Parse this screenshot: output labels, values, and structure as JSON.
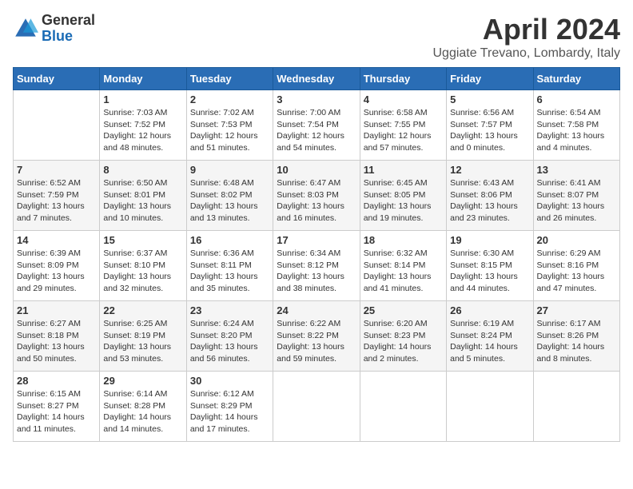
{
  "header": {
    "logo": {
      "general": "General",
      "blue": "Blue"
    },
    "title": "April 2024",
    "location": "Uggiate Trevano, Lombardy, Italy"
  },
  "calendar": {
    "days_of_week": [
      "Sunday",
      "Monday",
      "Tuesday",
      "Wednesday",
      "Thursday",
      "Friday",
      "Saturday"
    ],
    "weeks": [
      [
        {
          "day": "",
          "info": ""
        },
        {
          "day": "1",
          "info": "Sunrise: 7:03 AM\nSunset: 7:52 PM\nDaylight: 12 hours\nand 48 minutes."
        },
        {
          "day": "2",
          "info": "Sunrise: 7:02 AM\nSunset: 7:53 PM\nDaylight: 12 hours\nand 51 minutes."
        },
        {
          "day": "3",
          "info": "Sunrise: 7:00 AM\nSunset: 7:54 PM\nDaylight: 12 hours\nand 54 minutes."
        },
        {
          "day": "4",
          "info": "Sunrise: 6:58 AM\nSunset: 7:55 PM\nDaylight: 12 hours\nand 57 minutes."
        },
        {
          "day": "5",
          "info": "Sunrise: 6:56 AM\nSunset: 7:57 PM\nDaylight: 13 hours\nand 0 minutes."
        },
        {
          "day": "6",
          "info": "Sunrise: 6:54 AM\nSunset: 7:58 PM\nDaylight: 13 hours\nand 4 minutes."
        }
      ],
      [
        {
          "day": "7",
          "info": "Sunrise: 6:52 AM\nSunset: 7:59 PM\nDaylight: 13 hours\nand 7 minutes."
        },
        {
          "day": "8",
          "info": "Sunrise: 6:50 AM\nSunset: 8:01 PM\nDaylight: 13 hours\nand 10 minutes."
        },
        {
          "day": "9",
          "info": "Sunrise: 6:48 AM\nSunset: 8:02 PM\nDaylight: 13 hours\nand 13 minutes."
        },
        {
          "day": "10",
          "info": "Sunrise: 6:47 AM\nSunset: 8:03 PM\nDaylight: 13 hours\nand 16 minutes."
        },
        {
          "day": "11",
          "info": "Sunrise: 6:45 AM\nSunset: 8:05 PM\nDaylight: 13 hours\nand 19 minutes."
        },
        {
          "day": "12",
          "info": "Sunrise: 6:43 AM\nSunset: 8:06 PM\nDaylight: 13 hours\nand 23 minutes."
        },
        {
          "day": "13",
          "info": "Sunrise: 6:41 AM\nSunset: 8:07 PM\nDaylight: 13 hours\nand 26 minutes."
        }
      ],
      [
        {
          "day": "14",
          "info": "Sunrise: 6:39 AM\nSunset: 8:09 PM\nDaylight: 13 hours\nand 29 minutes."
        },
        {
          "day": "15",
          "info": "Sunrise: 6:37 AM\nSunset: 8:10 PM\nDaylight: 13 hours\nand 32 minutes."
        },
        {
          "day": "16",
          "info": "Sunrise: 6:36 AM\nSunset: 8:11 PM\nDaylight: 13 hours\nand 35 minutes."
        },
        {
          "day": "17",
          "info": "Sunrise: 6:34 AM\nSunset: 8:12 PM\nDaylight: 13 hours\nand 38 minutes."
        },
        {
          "day": "18",
          "info": "Sunrise: 6:32 AM\nSunset: 8:14 PM\nDaylight: 13 hours\nand 41 minutes."
        },
        {
          "day": "19",
          "info": "Sunrise: 6:30 AM\nSunset: 8:15 PM\nDaylight: 13 hours\nand 44 minutes."
        },
        {
          "day": "20",
          "info": "Sunrise: 6:29 AM\nSunset: 8:16 PM\nDaylight: 13 hours\nand 47 minutes."
        }
      ],
      [
        {
          "day": "21",
          "info": "Sunrise: 6:27 AM\nSunset: 8:18 PM\nDaylight: 13 hours\nand 50 minutes."
        },
        {
          "day": "22",
          "info": "Sunrise: 6:25 AM\nSunset: 8:19 PM\nDaylight: 13 hours\nand 53 minutes."
        },
        {
          "day": "23",
          "info": "Sunrise: 6:24 AM\nSunset: 8:20 PM\nDaylight: 13 hours\nand 56 minutes."
        },
        {
          "day": "24",
          "info": "Sunrise: 6:22 AM\nSunset: 8:22 PM\nDaylight: 13 hours\nand 59 minutes."
        },
        {
          "day": "25",
          "info": "Sunrise: 6:20 AM\nSunset: 8:23 PM\nDaylight: 14 hours\nand 2 minutes."
        },
        {
          "day": "26",
          "info": "Sunrise: 6:19 AM\nSunset: 8:24 PM\nDaylight: 14 hours\nand 5 minutes."
        },
        {
          "day": "27",
          "info": "Sunrise: 6:17 AM\nSunset: 8:26 PM\nDaylight: 14 hours\nand 8 minutes."
        }
      ],
      [
        {
          "day": "28",
          "info": "Sunrise: 6:15 AM\nSunset: 8:27 PM\nDaylight: 14 hours\nand 11 minutes."
        },
        {
          "day": "29",
          "info": "Sunrise: 6:14 AM\nSunset: 8:28 PM\nDaylight: 14 hours\nand 14 minutes."
        },
        {
          "day": "30",
          "info": "Sunrise: 6:12 AM\nSunset: 8:29 PM\nDaylight: 14 hours\nand 17 minutes."
        },
        {
          "day": "",
          "info": ""
        },
        {
          "day": "",
          "info": ""
        },
        {
          "day": "",
          "info": ""
        },
        {
          "day": "",
          "info": ""
        }
      ]
    ]
  }
}
